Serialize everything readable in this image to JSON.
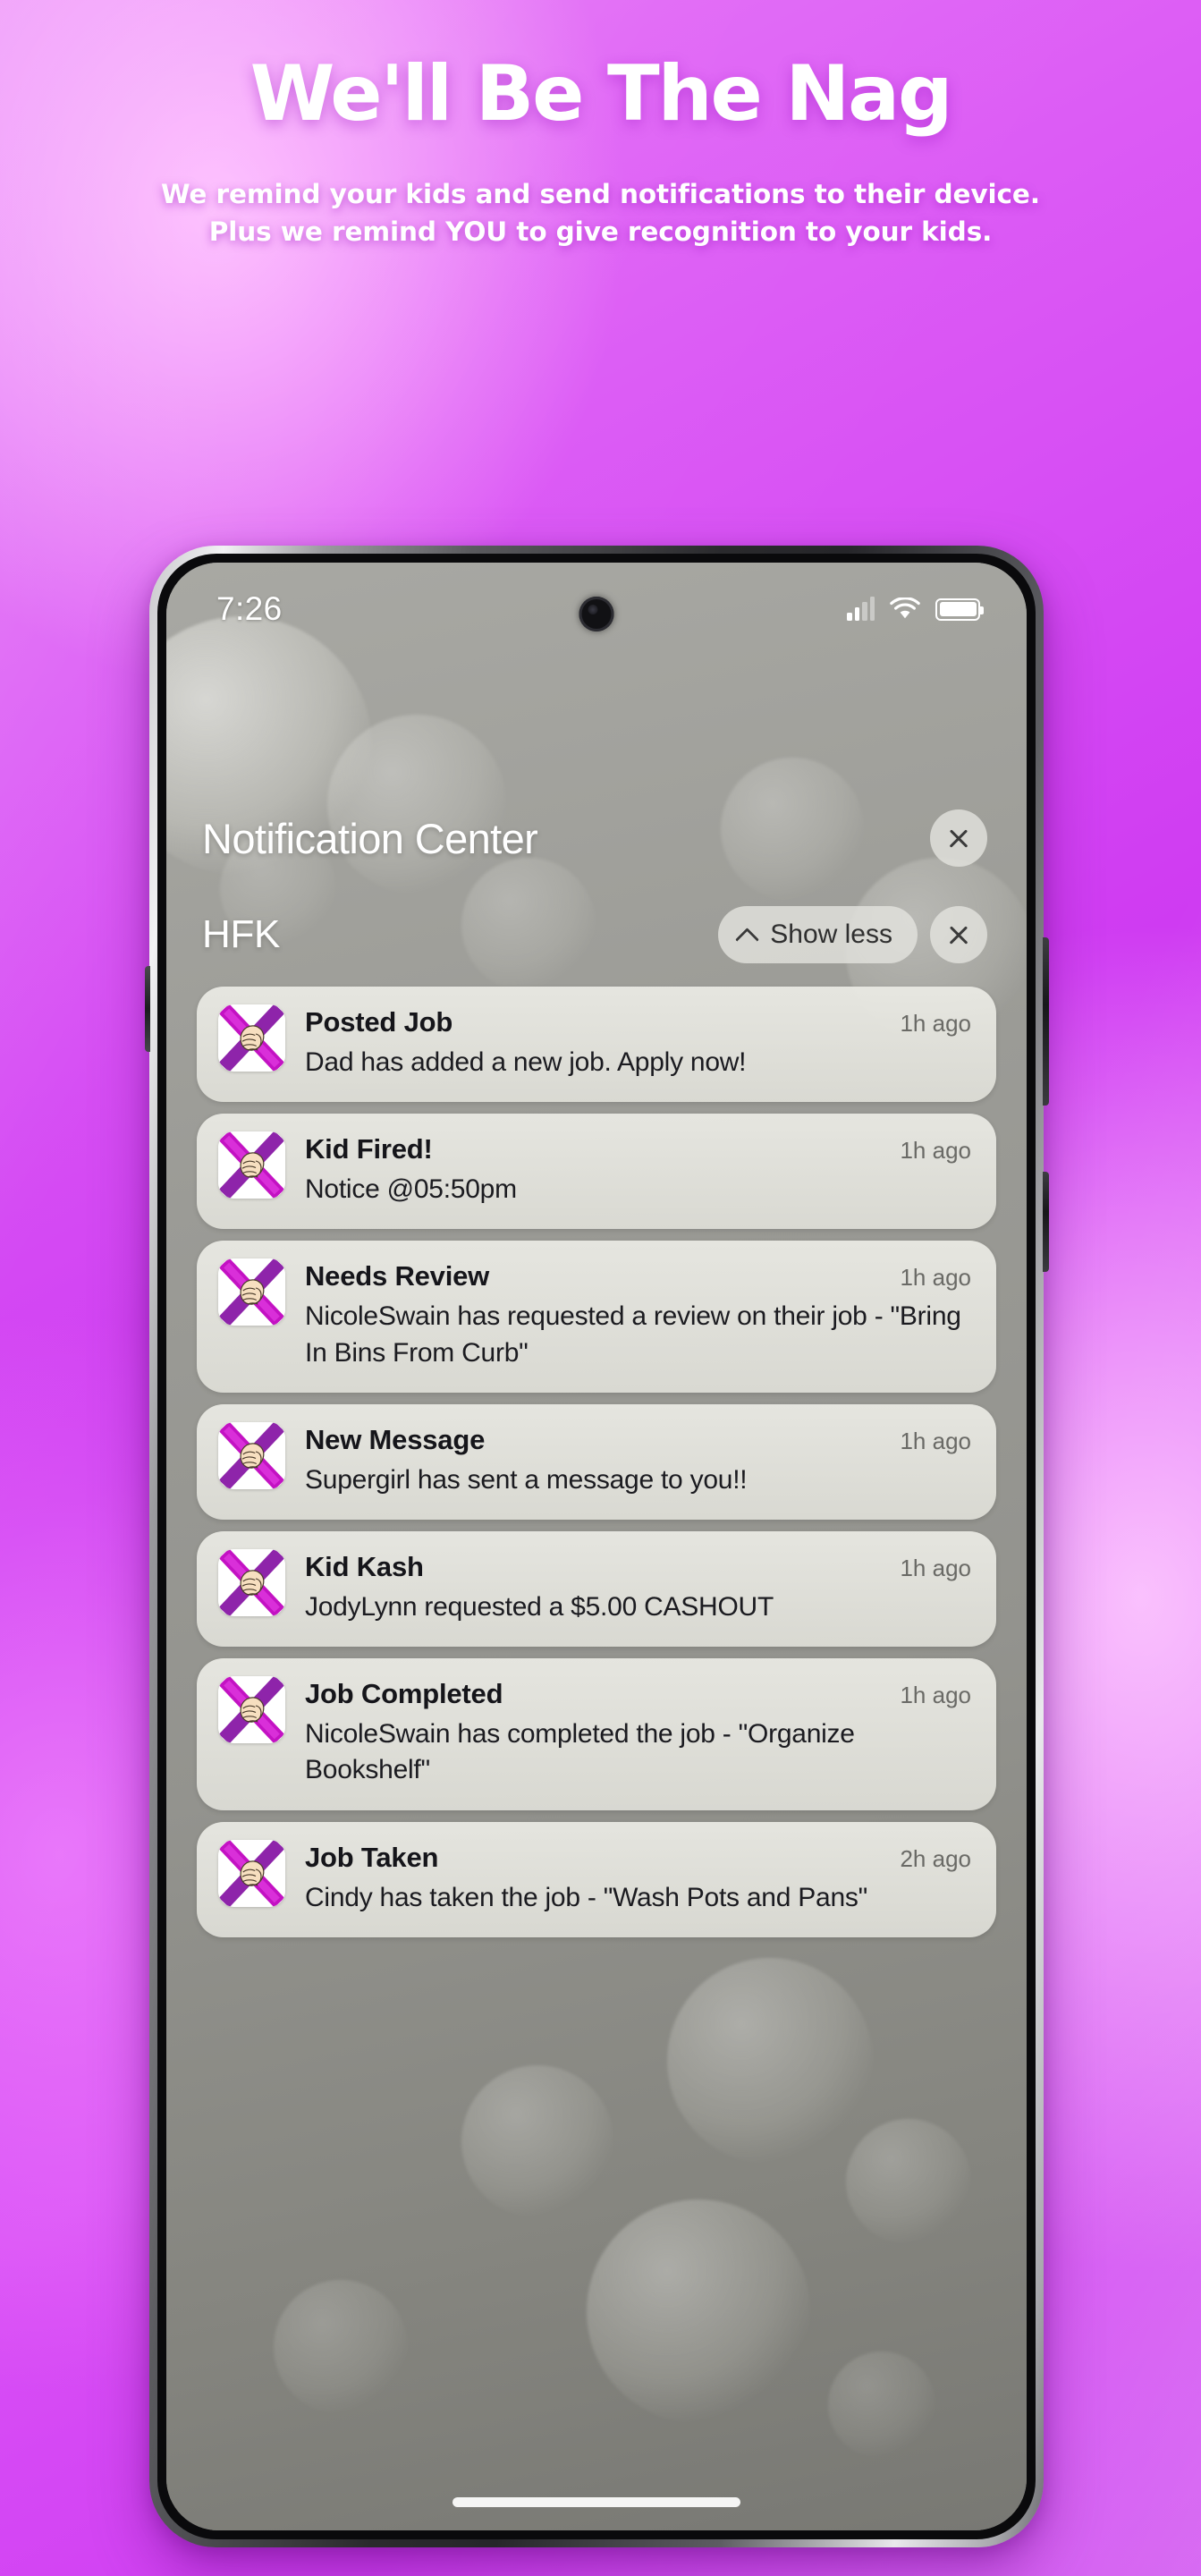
{
  "hero": {
    "title": "We'll Be The Nag",
    "subtitle": "We remind your kids and send notifications to their device. Plus we remind YOU to give recognition to your kids."
  },
  "colors": {
    "background_start": "#e77bf7",
    "background_end": "#c832ee",
    "accent_magenta": "#cc22cc",
    "accent_purple": "#7b1fa2",
    "card_background": "#ebebe5",
    "title_text": "#ffffff"
  },
  "phone": {
    "statusbar": {
      "time": "7:26",
      "signal_icon": "cellular-signal-icon",
      "wifi_icon": "wifi-icon",
      "battery_icon": "battery-full-icon",
      "camera_icon": "front-camera-punch-hole"
    },
    "notification_center": {
      "title": "Notification Center",
      "close_label": "close-icon",
      "group": {
        "name": "HFK",
        "show_less_label": "Show less",
        "chevron_icon": "chevron-up-icon",
        "close_icon": "close-icon"
      },
      "notifications": [
        {
          "app_icon": "hfk-app-icon",
          "title": "Posted Job",
          "time": "1h ago",
          "text": "Dad has added a new job. Apply now!"
        },
        {
          "app_icon": "hfk-app-icon",
          "title": "Kid Fired!",
          "time": "1h ago",
          "text": "Notice @05:50pm"
        },
        {
          "app_icon": "hfk-app-icon",
          "title": "Needs Review",
          "time": "1h ago",
          "text": "NicoleSwain has requested a review on their job - \"Bring In Bins From Curb\""
        },
        {
          "app_icon": "hfk-app-icon",
          "title": "New Message",
          "time": "1h ago",
          "text": "Supergirl has sent a message to you!!"
        },
        {
          "app_icon": "hfk-app-icon",
          "title": "Kid Kash",
          "time": "1h ago",
          "text": "JodyLynn requested a $5.00 CASHOUT"
        },
        {
          "app_icon": "hfk-app-icon",
          "title": "Job Completed",
          "time": "1h ago",
          "text": "NicoleSwain has completed the job - \"Organize Bookshelf\""
        },
        {
          "app_icon": "hfk-app-icon",
          "title": "Job Taken",
          "time": "2h ago",
          "text": "Cindy has taken the job - \"Wash Pots and Pans\""
        }
      ]
    },
    "home_indicator": "home-indicator-bar"
  }
}
